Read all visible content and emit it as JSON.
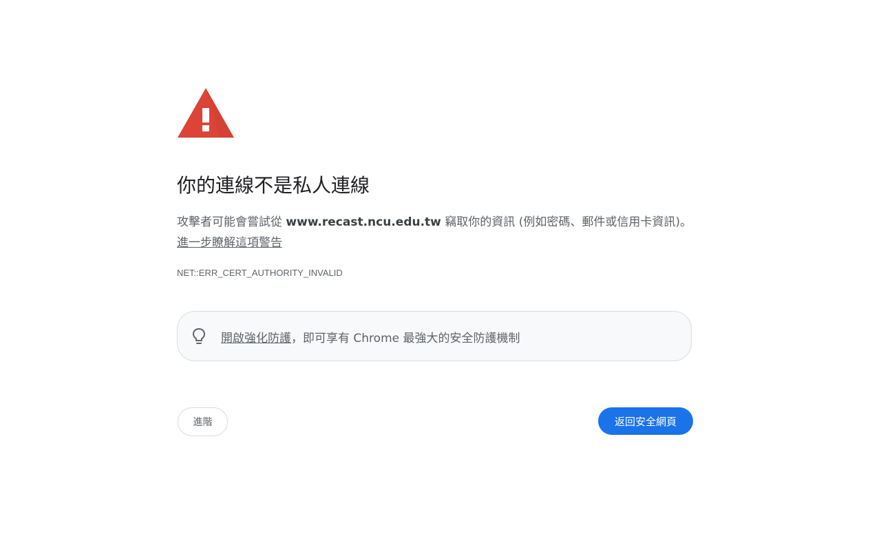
{
  "interstitial": {
    "heading": "你的連線不是私人連線",
    "explanation_prefix": "攻擊者可能會嘗試從 ",
    "host": "www.recast.ncu.edu.tw",
    "explanation_suffix": " 竊取你的資訊 (例如密碼、郵件或信用卡資訊)。",
    "learn_more_link": "進一步瞭解這項警告",
    "error_code": "NET::ERR_CERT_AUTHORITY_INVALID"
  },
  "promo": {
    "link": "開啟強化防護",
    "text": "，即可享有 Chrome 最強大的安全防護機制",
    "icon": "lightbulb-icon"
  },
  "buttons": {
    "advanced": "進階",
    "back_to_safety": "返回安全網頁"
  },
  "colors": {
    "warning_red": "#db4437",
    "primary_blue": "#1a73e8",
    "text_gray": "#5f6368"
  }
}
